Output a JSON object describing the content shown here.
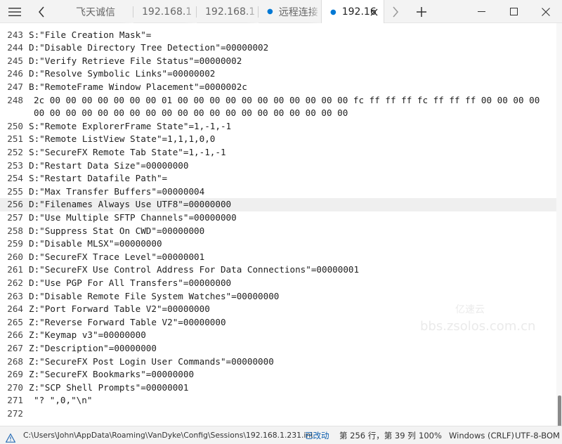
{
  "tabs": [
    {
      "label": "飞天诚信"
    },
    {
      "label": "192.168.1"
    },
    {
      "label": "192.168.1"
    },
    {
      "label": "远程连接"
    },
    {
      "label": "192.16"
    }
  ],
  "editor": {
    "current_line": 256,
    "lines": [
      {
        "num": "243",
        "text": "S:\"File Creation Mask\"="
      },
      {
        "num": "244",
        "text": "D:\"Disable Directory Tree Detection\"=00000002"
      },
      {
        "num": "245",
        "text": "D:\"Verify Retrieve File Status\"=00000002"
      },
      {
        "num": "246",
        "text": "D:\"Resolve Symbolic Links\"=00000002"
      },
      {
        "num": "247",
        "text": "B:\"RemoteFrame Window Placement\"=0000002c"
      },
      {
        "num": "248",
        "text": "2c 00 00 00 00 00 00 00 01 00 00 00 00 00 00 00 00 00 00 00 fc ff ff ff fc ff ff ff 00 00 00 00"
      },
      {
        "num": "",
        "text": "00 00 00 00 00 00 00 00 00 00 00 00 00 00 00 00 00 00 00 00"
      },
      {
        "num": "250",
        "text": "S:\"Remote ExplorerFrame State\"=1,-1,-1"
      },
      {
        "num": "251",
        "text": "S:\"Remote ListView State\"=1,1,1,0,0"
      },
      {
        "num": "252",
        "text": "S:\"SecureFX Remote Tab State\"=1,-1,-1"
      },
      {
        "num": "253",
        "text": "D:\"Restart Data Size\"=00000000"
      },
      {
        "num": "254",
        "text": "S:\"Restart Datafile Path\"="
      },
      {
        "num": "255",
        "text": "D:\"Max Transfer Buffers\"=00000004"
      },
      {
        "num": "256",
        "text": "D:\"Filenames Always Use UTF8\"=00000000"
      },
      {
        "num": "257",
        "text": "D:\"Use Multiple SFTP Channels\"=00000000"
      },
      {
        "num": "258",
        "text": "D:\"Suppress Stat On CWD\"=00000000"
      },
      {
        "num": "259",
        "text": "D:\"Disable MLSX\"=00000000"
      },
      {
        "num": "260",
        "text": "D:\"SecureFX Trace Level\"=00000001"
      },
      {
        "num": "261",
        "text": "D:\"SecureFX Use Control Address For Data Connections\"=00000001"
      },
      {
        "num": "262",
        "text": "D:\"Use PGP For All Transfers\"=00000000"
      },
      {
        "num": "263",
        "text": "D:\"Disable Remote File System Watches\"=00000000"
      },
      {
        "num": "264",
        "text": "Z:\"Port Forward Table V2\"=00000000"
      },
      {
        "num": "265",
        "text": "Z:\"Reverse Forward Table V2\"=00000000"
      },
      {
        "num": "266",
        "text": "Z:\"Keymap v3\"=00000000"
      },
      {
        "num": "267",
        "text": "Z:\"Description\"=00000000"
      },
      {
        "num": "268",
        "text": "Z:\"SecureFX Post Login User Commands\"=00000000"
      },
      {
        "num": "269",
        "text": "Z:\"SecureFX Bookmarks\"=00000000"
      },
      {
        "num": "270",
        "text": "Z:\"SCP Shell Prompts\"=00000001"
      },
      {
        "num": "271",
        "text": "\"? \",0,\"\\n\""
      },
      {
        "num": "272",
        "text": ""
      }
    ]
  },
  "watermark": {
    "line1": "亿速云",
    "line2": "bbs.zsolos.com.cn"
  },
  "status": {
    "filepath": "C:\\Users\\John\\AppData\\Roaming\\VanDyke\\Config\\Sessions\\192.168.1.231.ini",
    "modified": "已改动",
    "position": "第 256 行，第 39 列",
    "zoom": "100%",
    "eol": "Windows (CRLF)",
    "encoding": "UTF-8-BOM"
  },
  "icons": {
    "menu": "hamburger-icon",
    "back": "chevron-left-icon",
    "forward": "chevron-right-icon",
    "new_tab": "plus-icon",
    "tab_close": "close-icon",
    "minimize": "minimize-icon",
    "maximize": "maximize-icon",
    "close_window": "close-icon",
    "status_warning": "warning-icon"
  },
  "colors": {
    "accent": "#0078d4",
    "modified": "#0b5cad",
    "current_line": "#efefef"
  }
}
